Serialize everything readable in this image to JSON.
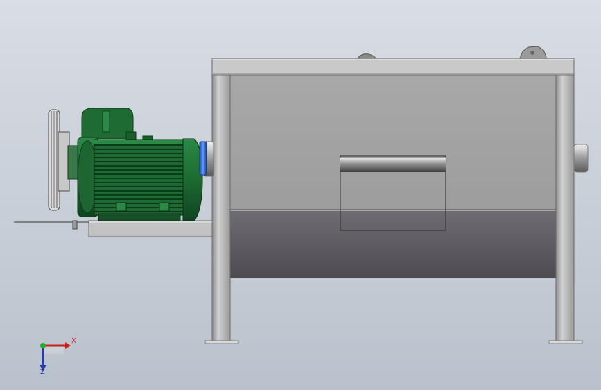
{
  "viewport": {
    "background_top": "#d9dde4",
    "background_bottom": "#b9c2cc"
  },
  "triad": {
    "x_label": "X",
    "z_label": "Z",
    "x_color": "#c62020",
    "y_color": "#1fae2a",
    "z_color": "#2a3ab0"
  },
  "model": {
    "motor_color": "#1e6b33",
    "frame_color": "#b7b7b7",
    "tank_lower_color": "#5c5a60",
    "flange_color": "#2f6fd1"
  }
}
